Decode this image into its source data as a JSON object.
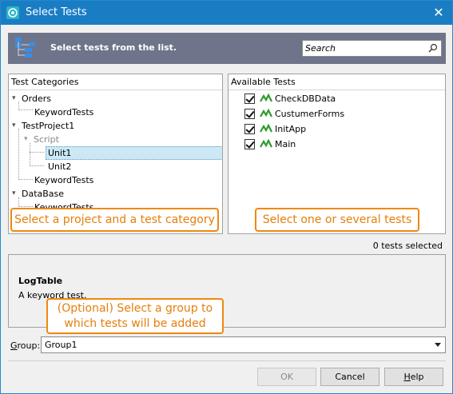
{
  "window": {
    "title": "Select Tests",
    "close_glyph": "✕"
  },
  "banner": {
    "text": "Select tests from the list.",
    "icon": "tree-structure-icon",
    "search_placeholder": "Search"
  },
  "categories": {
    "header": "Test Categories",
    "items": [
      {
        "label": "Orders",
        "level": 0,
        "expanded": true
      },
      {
        "label": "KeywordTests",
        "level": 1
      },
      {
        "label": "TestProject1",
        "level": 0,
        "expanded": true
      },
      {
        "label": "Script",
        "level": 1,
        "expanded": true,
        "muted": true
      },
      {
        "label": "Unit1",
        "level": 2,
        "selected": true
      },
      {
        "label": "Unit2",
        "level": 2
      },
      {
        "label": "KeywordTests",
        "level": 1
      },
      {
        "label": "DataBase",
        "level": 0,
        "expanded": true
      },
      {
        "label": "KeywordTests",
        "level": 1
      }
    ],
    "callout": "Select a project and a test category"
  },
  "tests": {
    "header": "Available Tests",
    "items": [
      {
        "label": "CheckDBData",
        "checked": true
      },
      {
        "label": "CustumerForms",
        "checked": true
      },
      {
        "label": "InitApp",
        "checked": true
      },
      {
        "label": "Main",
        "checked": true
      }
    ],
    "callout": "Select one or several tests"
  },
  "selected_count": "0 tests selected",
  "description": {
    "title": "LogTable",
    "text": "A keyword test.",
    "callout_line1": "(Optional) Select a group to",
    "callout_line2": "which tests will be added"
  },
  "group": {
    "label": "Group:",
    "value": "Group1"
  },
  "buttons": {
    "ok": "OK",
    "cancel": "Cancel",
    "help": "Help"
  },
  "colors": {
    "titlebar": "#1a7dc4",
    "banner": "#6e7489",
    "callout": "#f0880f",
    "selection": "#cce8f5"
  }
}
